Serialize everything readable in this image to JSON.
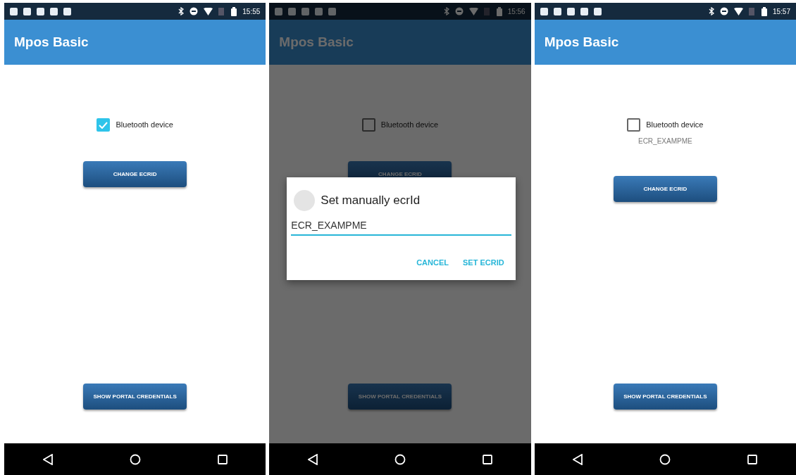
{
  "screens": [
    {
      "status_bar": {
        "time": "15:55"
      },
      "app_bar": {
        "title": "Mpos Basic"
      },
      "checkbox": {
        "label": "Bluetooth device",
        "checked": true
      },
      "buttons": [
        "CHANGE ECRID",
        "SHOW PORTAL CREDENTIALS"
      ]
    },
    {
      "status_bar": {
        "time": "15:56"
      },
      "app_bar": {
        "title": "Mpos Basic"
      },
      "checkbox": {
        "label": "Bluetooth device",
        "checked": false
      },
      "buttons": [
        "CHANGE ECRID",
        "SHOW PORTAL CREDENTIALS"
      ],
      "dialog": {
        "title": "Set manually ecrId",
        "value": "ECR_EXAMPME",
        "actions": [
          "CANCEL",
          "SET ECRID"
        ]
      }
    },
    {
      "status_bar": {
        "time": "15:57"
      },
      "app_bar": {
        "title": "Mpos Basic"
      },
      "checkbox": {
        "label": "Bluetooth device",
        "checked": false
      },
      "ecrid": "ECR_EXAMPME",
      "buttons": [
        "CHANGE ECRID",
        "SHOW PORTAL CREDENTIALS"
      ]
    }
  ]
}
